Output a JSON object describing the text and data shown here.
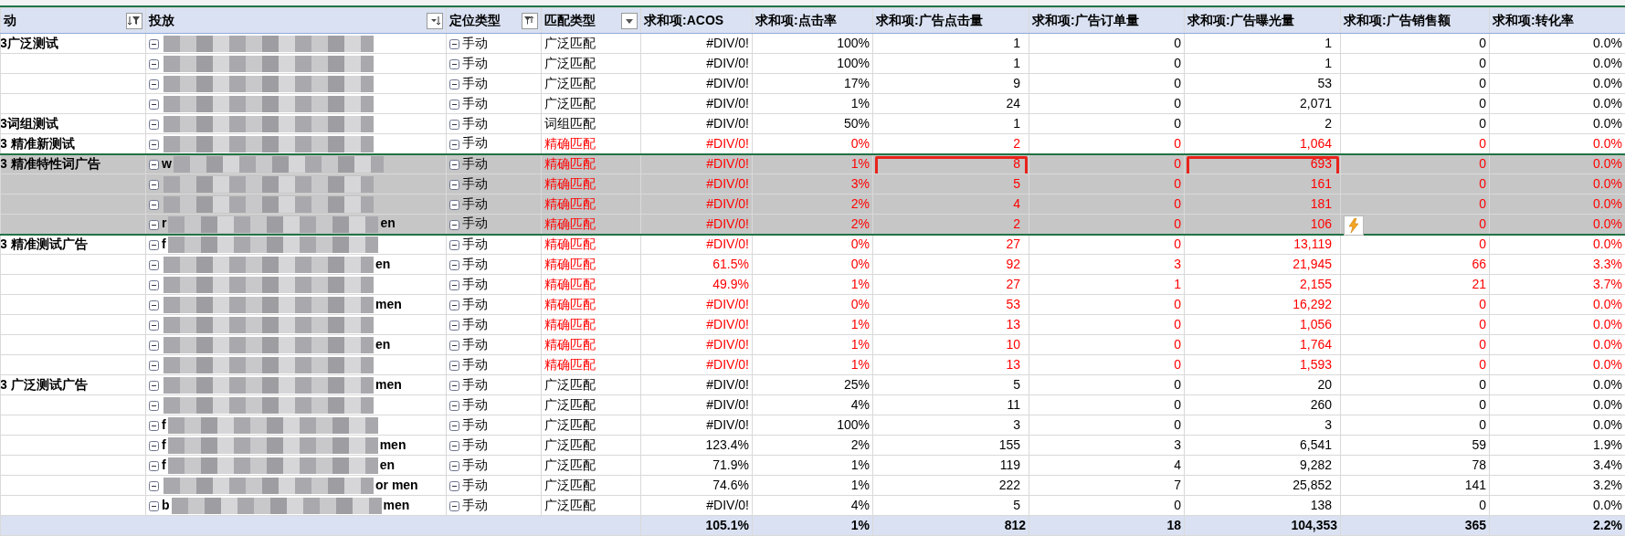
{
  "columns": [
    {
      "label": "动",
      "filtered": true,
      "sorted": true
    },
    {
      "label": "投放",
      "filtered": false,
      "sorted": true
    },
    {
      "label": "定位类型",
      "filtered": true,
      "sorted": false
    },
    {
      "label": "匹配类型",
      "filtered": false,
      "sorted": false
    },
    {
      "label": "求和项:ACOS"
    },
    {
      "label": "求和项:点击率"
    },
    {
      "label": "求和项:广告点击量",
      "boxed": true
    },
    {
      "label": "求和项:广告订单量"
    },
    {
      "label": "求和项:广告曝光量",
      "boxed": true
    },
    {
      "label": "求和项:广告销售额"
    },
    {
      "label": "求和项:转化率"
    }
  ],
  "rows": [
    {
      "campaign": "3广泛测试",
      "targeting": "手动",
      "match_type": "广泛匹配",
      "alert": false,
      "selected": false,
      "values": [
        "#DIV/0!",
        "100%",
        "1",
        "0",
        "1",
        "0",
        "0.0%"
      ]
    },
    {
      "targeting": "手动",
      "match_type": "广泛匹配",
      "alert": false,
      "selected": false,
      "values": [
        "#DIV/0!",
        "100%",
        "1",
        "0",
        "1",
        "0",
        "0.0%"
      ]
    },
    {
      "targeting": "手动",
      "match_type": "广泛匹配",
      "alert": false,
      "selected": false,
      "values": [
        "#DIV/0!",
        "17%",
        "9",
        "0",
        "53",
        "0",
        "0.0%"
      ]
    },
    {
      "targeting": "手动",
      "match_type": "广泛匹配",
      "alert": false,
      "selected": false,
      "values": [
        "#DIV/0!",
        "1%",
        "24",
        "0",
        "2,071",
        "0",
        "0.0%"
      ]
    },
    {
      "campaign": "3词组测试",
      "targeting": "手动",
      "match_type": "词组匹配",
      "alert": false,
      "selected": false,
      "values": [
        "#DIV/0!",
        "50%",
        "1",
        "0",
        "2",
        "0",
        "0.0%"
      ]
    },
    {
      "campaign": "3 精准新测试",
      "targeting": "手动",
      "match_type": "精确匹配",
      "alert": true,
      "selected": false,
      "values": [
        "#DIV/0!",
        "0%",
        "2",
        "0",
        "1,064",
        "0",
        "0.0%"
      ]
    },
    {
      "campaign": "3 精准特性词广告",
      "prefix": "w",
      "targeting": "手动",
      "match_type": "精确匹配",
      "alert": true,
      "selected": true,
      "values": [
        "#DIV/0!",
        "1%",
        "8",
        "0",
        "693",
        "0",
        "0.0%"
      ]
    },
    {
      "targeting": "手动",
      "match_type": "精确匹配",
      "alert": true,
      "selected": true,
      "values": [
        "#DIV/0!",
        "3%",
        "5",
        "0",
        "161",
        "0",
        "0.0%"
      ]
    },
    {
      "targeting": "手动",
      "match_type": "精确匹配",
      "alert": true,
      "selected": true,
      "values": [
        "#DIV/0!",
        "2%",
        "4",
        "0",
        "181",
        "0",
        "0.0%"
      ]
    },
    {
      "prefix": "r",
      "suffix": "en",
      "targeting": "手动",
      "match_type": "精确匹配",
      "alert": true,
      "selected": true,
      "quick_analysis": true,
      "values": [
        "#DIV/0!",
        "2%",
        "2",
        "0",
        "106",
        "0",
        "0.0%"
      ]
    },
    {
      "campaign": "3 精准测试广告",
      "prefix": "f",
      "targeting": "手动",
      "match_type": "精确匹配",
      "alert": true,
      "selected": false,
      "values": [
        "#DIV/0!",
        "0%",
        "27",
        "0",
        "13,119",
        "0",
        "0.0%"
      ]
    },
    {
      "suffix": "en",
      "targeting": "手动",
      "match_type": "精确匹配",
      "alert": true,
      "selected": false,
      "values": [
        "61.5%",
        "0%",
        "92",
        "3",
        "21,945",
        "66",
        "3.3%"
      ]
    },
    {
      "targeting": "手动",
      "match_type": "精确匹配",
      "alert": true,
      "selected": false,
      "values": [
        "49.9%",
        "1%",
        "27",
        "1",
        "2,155",
        "21",
        "3.7%"
      ]
    },
    {
      "suffix": "men",
      "targeting": "手动",
      "match_type": "精确匹配",
      "alert": true,
      "selected": false,
      "values": [
        "#DIV/0!",
        "0%",
        "53",
        "0",
        "16,292",
        "0",
        "0.0%"
      ]
    },
    {
      "targeting": "手动",
      "match_type": "精确匹配",
      "alert": true,
      "selected": false,
      "values": [
        "#DIV/0!",
        "1%",
        "13",
        "0",
        "1,056",
        "0",
        "0.0%"
      ]
    },
    {
      "suffix": "en",
      "targeting": "手动",
      "match_type": "精确匹配",
      "alert": true,
      "selected": false,
      "values": [
        "#DIV/0!",
        "1%",
        "10",
        "0",
        "1,764",
        "0",
        "0.0%"
      ]
    },
    {
      "targeting": "手动",
      "match_type": "精确匹配",
      "alert": true,
      "selected": false,
      "values": [
        "#DIV/0!",
        "1%",
        "13",
        "0",
        "1,593",
        "0",
        "0.0%"
      ]
    },
    {
      "campaign": "3 广泛测试广告",
      "suffix": "men",
      "targeting": "手动",
      "match_type": "广泛匹配",
      "alert": false,
      "selected": false,
      "values": [
        "#DIV/0!",
        "25%",
        "5",
        "0",
        "20",
        "0",
        "0.0%"
      ]
    },
    {
      "targeting": "手动",
      "match_type": "广泛匹配",
      "alert": false,
      "selected": false,
      "values": [
        "#DIV/0!",
        "4%",
        "11",
        "0",
        "260",
        "0",
        "0.0%"
      ]
    },
    {
      "prefix": "f",
      "targeting": "手动",
      "match_type": "广泛匹配",
      "alert": false,
      "selected": false,
      "values": [
        "#DIV/0!",
        "100%",
        "3",
        "0",
        "3",
        "0",
        "0.0%"
      ]
    },
    {
      "prefix": "f",
      "suffix": "men",
      "targeting": "手动",
      "match_type": "广泛匹配",
      "alert": false,
      "selected": false,
      "values": [
        "123.4%",
        "2%",
        "155",
        "3",
        "6,541",
        "59",
        "1.9%"
      ]
    },
    {
      "prefix": "f",
      "suffix": "en",
      "targeting": "手动",
      "match_type": "广泛匹配",
      "alert": false,
      "selected": false,
      "values": [
        "71.9%",
        "1%",
        "119",
        "4",
        "9,282",
        "78",
        "3.4%"
      ]
    },
    {
      "suffix": "or men",
      "targeting": "手动",
      "match_type": "广泛匹配",
      "alert": false,
      "selected": false,
      "values": [
        "74.6%",
        "1%",
        "222",
        "7",
        "25,852",
        "141",
        "3.2%"
      ]
    },
    {
      "prefix": "b",
      "suffix": "men",
      "targeting": "手动",
      "match_type": "广泛匹配",
      "alert": false,
      "selected": false,
      "values": [
        "#DIV/0!",
        "4%",
        "5",
        "0",
        "138",
        "0",
        "0.0%"
      ]
    }
  ],
  "total": {
    "values": [
      "105.1%",
      "1%",
      "812",
      "18",
      "104,353",
      "365",
      "2.2%"
    ]
  }
}
